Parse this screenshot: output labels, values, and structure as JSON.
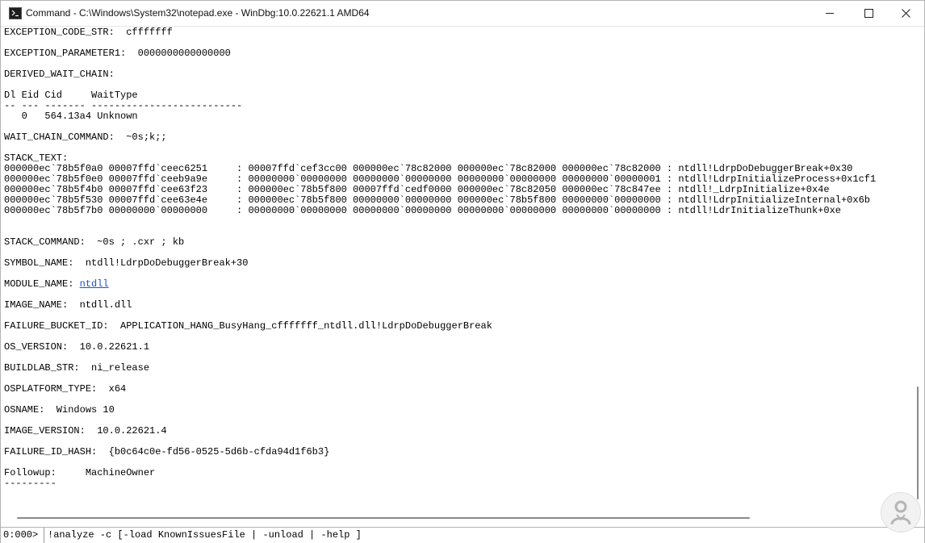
{
  "window": {
    "title": "Command - C:\\Windows\\System32\\notepad.exe - WinDbg:10.0.22621.1 AMD64"
  },
  "output_lines": [
    "EXCEPTION_CODE_STR:  cfffffff",
    "",
    "EXCEPTION_PARAMETER1:  0000000000000000",
    "",
    "DERIVED_WAIT_CHAIN:",
    "",
    "Dl Eid Cid     WaitType",
    "-- --- ------- --------------------------",
    "   0   564.13a4 Unknown",
    "",
    "WAIT_CHAIN_COMMAND:  ~0s;k;;",
    "",
    "STACK_TEXT:",
    "000000ec`78b5f0a0 00007ffd`ceec6251     : 00007ffd`cef3cc00 000000ec`78c82000 000000ec`78c82000 000000ec`78c82000 : ntdll!LdrpDoDebuggerBreak+0x30",
    "000000ec`78b5f0e0 00007ffd`ceeb9a9e     : 00000000`00000000 00000000`00000000 00000000`00000000 00000000`00000001 : ntdll!LdrpInitializeProcess+0x1cf1",
    "000000ec`78b5f4b0 00007ffd`cee63f23     : 000000ec`78b5f800 00007ffd`cedf0000 000000ec`78c82050 000000ec`78c847ee : ntdll!_LdrpInitialize+0x4e",
    "000000ec`78b5f530 00007ffd`cee63e4e     : 000000ec`78b5f800 00000000`00000000 000000ec`78b5f800 00000000`00000000 : ntdll!LdrpInitializeInternal+0x6b",
    "000000ec`78b5f7b0 00000000`00000000     : 00000000`00000000 00000000`00000000 00000000`00000000 00000000`00000000 : ntdll!LdrInitializeThunk+0xe",
    "",
    "",
    "STACK_COMMAND:  ~0s ; .cxr ; kb",
    "",
    "SYMBOL_NAME:  ntdll!LdrpDoDebuggerBreak+30",
    "",
    "MODULE_NAME: ",
    "",
    "IMAGE_NAME:  ntdll.dll",
    "",
    "FAILURE_BUCKET_ID:  APPLICATION_HANG_BusyHang_cfffffff_ntdll.dll!LdrpDoDebuggerBreak",
    "",
    "OS_VERSION:  10.0.22621.1",
    "",
    "BUILDLAB_STR:  ni_release",
    "",
    "OSPLATFORM_TYPE:  x64",
    "",
    "OSNAME:  Windows 10",
    "",
    "IMAGE_VERSION:  10.0.22621.4",
    "",
    "FAILURE_ID_HASH:  {b0c64c0e-fd56-0525-5d6b-cfda94d1f6b3}",
    "",
    "Followup:     MachineOwner",
    "---------"
  ],
  "module_link": "ntdll",
  "command_bar": {
    "prompt": "0:000>",
    "input_value": "!analyze -c [-load KnownIssuesFile | -unload | -help ]"
  }
}
